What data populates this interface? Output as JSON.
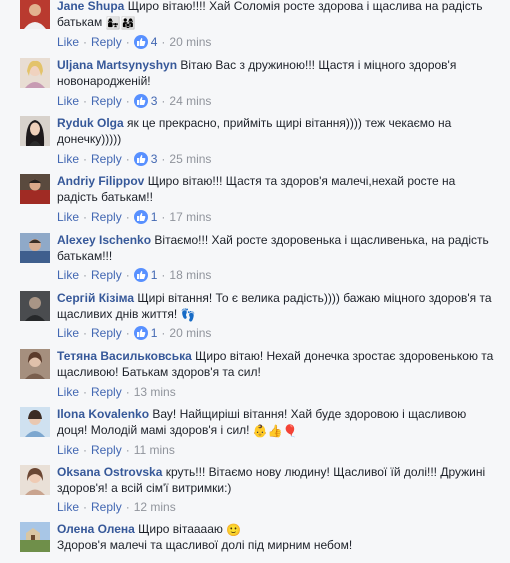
{
  "actions": {
    "like": "Like",
    "reply": "Reply",
    "separator": "·"
  },
  "comments": [
    {
      "author": "Jane Shupa",
      "text": "Щиро вітаю!!!! Хай Соломія росте здорова і щаслива на радість батькам",
      "emoji": "👩‍👧👨‍👩‍👧",
      "likes": "4",
      "time": "20 mins",
      "avatar_color": "#b93a2f"
    },
    {
      "author": "Uljana Martsynyshyn",
      "text": "Вітаю Вас з дружиною!!! Щастя і міцного здоров'я новонародженій!",
      "emoji": "",
      "likes": "3",
      "time": "24 mins",
      "avatar_color": "#d9c7b8"
    },
    {
      "author": "Ryduk Olga",
      "text": "як це прекрасно, прийміть щирі вітання)))) теж чекаємо на донечку)))))",
      "emoji": "",
      "likes": "3",
      "time": "25 mins",
      "avatar_color": "#2c2a2e"
    },
    {
      "author": "Andriy Filippov",
      "text": "Щиро вітаю!!! Щастя та здоров'я малечі,нехай росте на радість батькам!!",
      "emoji": "",
      "likes": "1",
      "time": "17 mins",
      "avatar_color": "#a02b24"
    },
    {
      "author": "Alexey Ischenko",
      "text": "Вітаємо!!! Хай росте здоровенька і щасливенька, на радість батькам!!!",
      "emoji": "",
      "likes": "1",
      "time": "18 mins",
      "avatar_color": "#3f5f8e"
    },
    {
      "author": "Сергій Кізіма",
      "text": "Щирі вітання! То є велика радість)))) бажаю міцного здоров'я та щасливих днів життя!",
      "emoji": "👣",
      "likes": "1",
      "time": "20 mins",
      "avatar_color": "#3a3c3e"
    },
    {
      "author": "Тетяна Васильковська",
      "text": "Щиро вітаю! Нехай донечка зростає здоровенькою та щасливою! Батькам здоров'я та сил!",
      "emoji": "",
      "likes": "",
      "time": "13 mins",
      "avatar_color": "#7a5f4e"
    },
    {
      "author": "Ilona Kovalenko",
      "text": "Вау! Найщиріші вітання! Хай буде здоровою і щасливою доця! Молодій мамі здоров'я і сил!",
      "emoji": "👶👍🎈",
      "likes": "",
      "time": "11 mins",
      "avatar_color": "#7da7cf"
    },
    {
      "author": "Oksana Ostrovska",
      "text": "круть!!! Вітаємо нову людину! Щасливої їй долі!!! Дружині здоров'я! а всій сім'ї витримки:)",
      "emoji": "",
      "likes": "",
      "time": "12 mins",
      "avatar_color": "#c9a48f"
    },
    {
      "author": "Олена Олена",
      "text": "Щиро вітааааю",
      "emoji": "🙂",
      "text2": "Здоров'я малечі та щасливої долі під мирним небом!",
      "likes": "",
      "time": "",
      "avatar_color": "#8fb0d6"
    }
  ]
}
